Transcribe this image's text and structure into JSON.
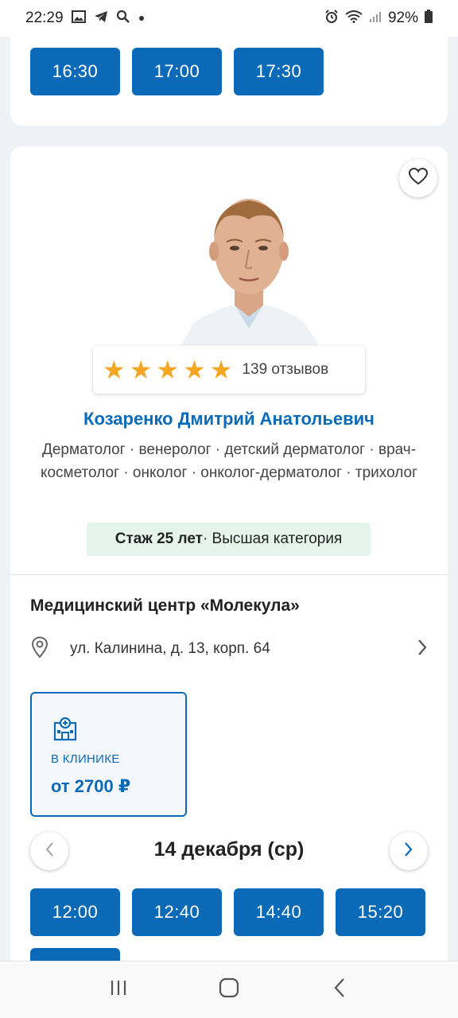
{
  "status_bar": {
    "time": "22:29",
    "battery": "92%"
  },
  "top_slots": [
    "16:30",
    "17:00",
    "17:30"
  ],
  "doctor": {
    "rating_stars": 5,
    "reviews": "139 отзывов",
    "name": "Козаренко Дмитрий Анатольевич",
    "specialties": "Дерматолог · венеролог · детский дерматолог · врач-косметолог · онколог · онколог-дерматолог · трихолог",
    "experience": "Стаж 25 лет",
    "category": " · Высшая категория"
  },
  "clinic": {
    "name": "Медицинский центр «Молекула»",
    "address": "ул. Калинина, д. 13, корп. 64"
  },
  "price": {
    "label": "В КЛИНИКЕ",
    "value": "от 2700 ₽"
  },
  "schedule": {
    "date": "14 декабря (ср)",
    "slots": [
      "12:00",
      "12:40",
      "14:40",
      "15:20"
    ]
  },
  "colors": {
    "primary": "#0a6ab8",
    "star": "#f5a623",
    "badge_bg": "#e6f4ee"
  }
}
